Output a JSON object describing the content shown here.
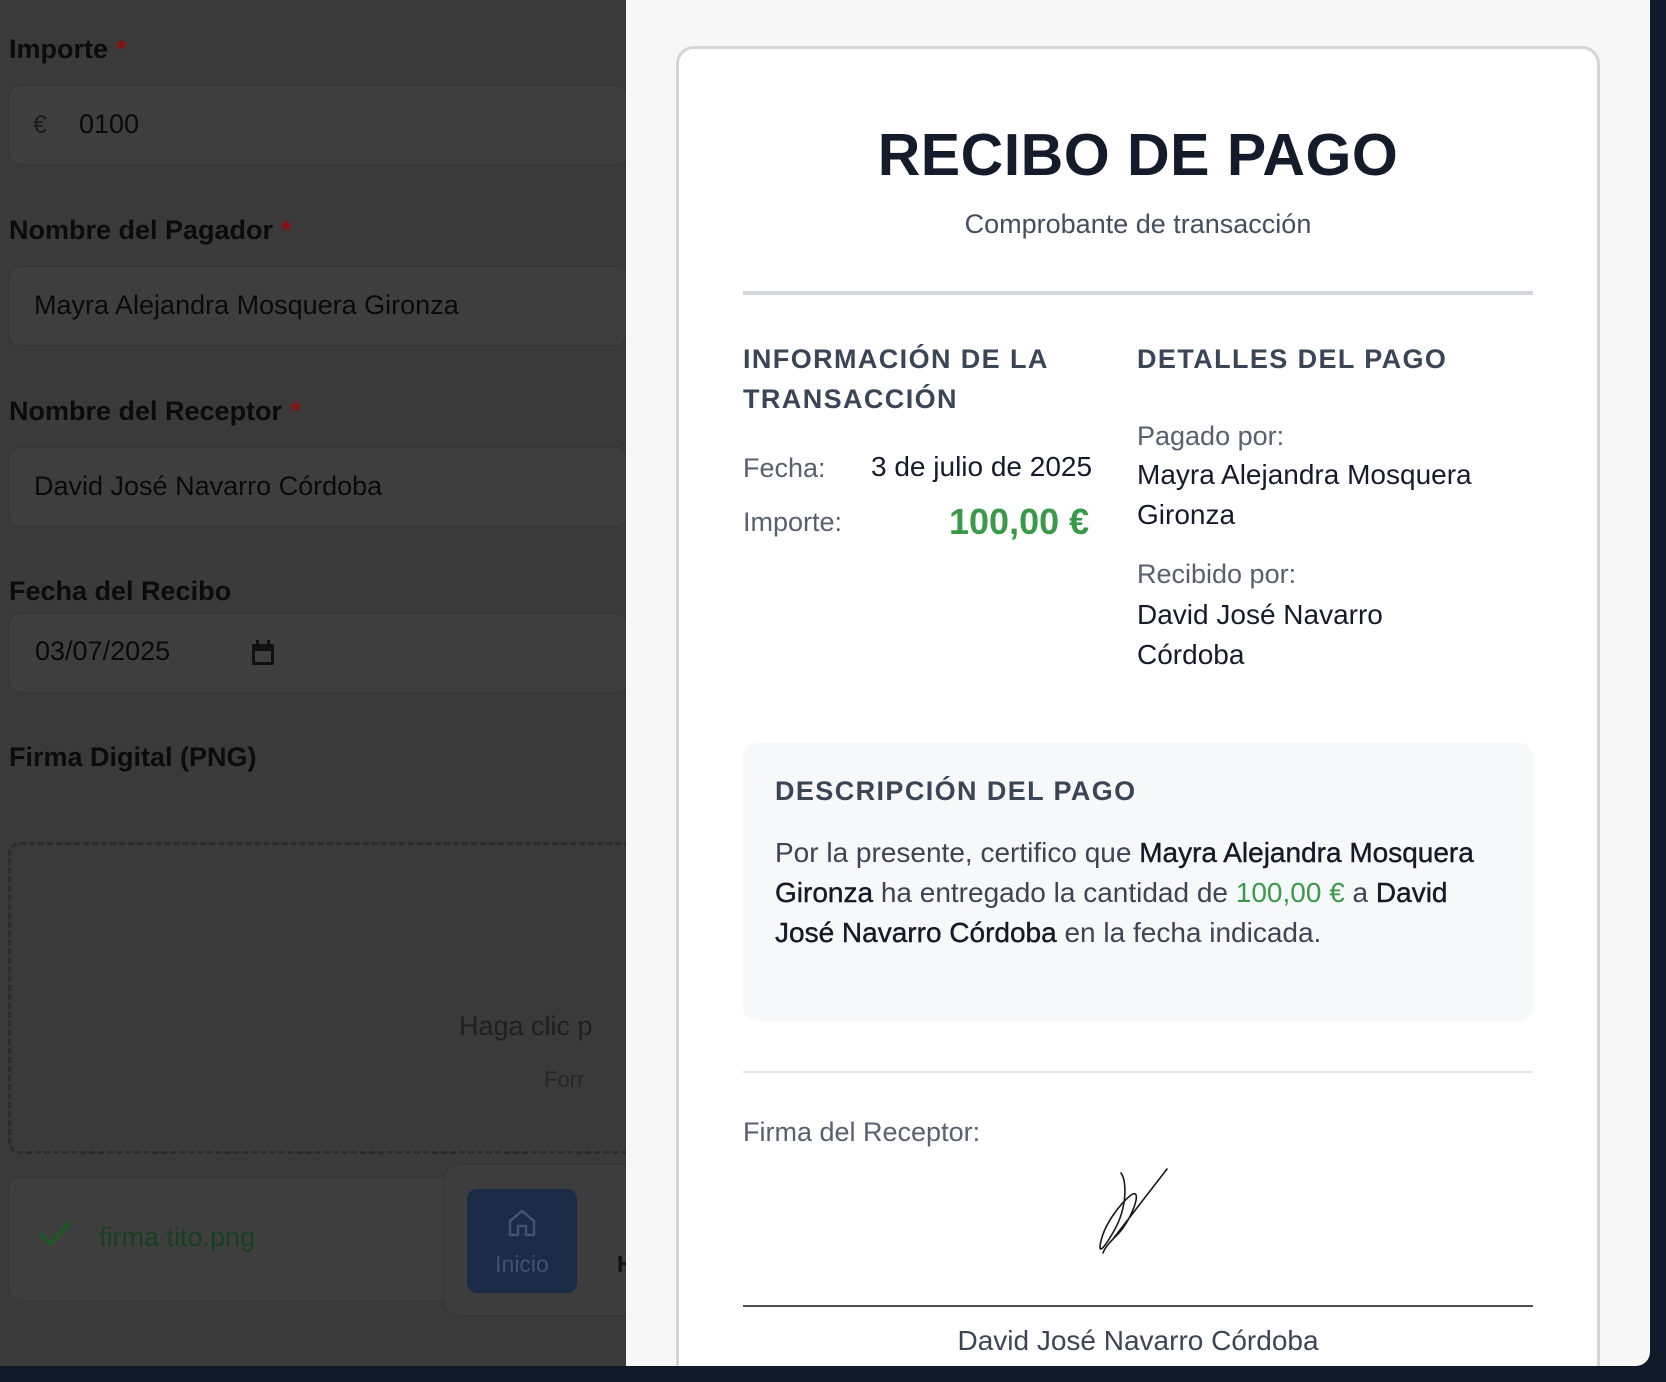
{
  "form": {
    "amount": {
      "label": "Importe",
      "required": "*",
      "currency": "€",
      "value": "0100"
    },
    "payer": {
      "label": "Nombre del Pagador",
      "required": "*",
      "value": "Mayra Alejandra Mosquera Gironza"
    },
    "receiver": {
      "label": "Nombre del Receptor",
      "required": "*",
      "value": "David José Navarro Córdoba"
    },
    "date": {
      "label": "Fecha del Recibo",
      "value": "03/07/2025"
    },
    "signature": {
      "label": "Firma Digital (PNG)",
      "dropzone_text": "Haga clic p",
      "dropzone_hint": "Forr",
      "file_name": "firma tito.png"
    },
    "nav": {
      "home_label": "Inicio",
      "next_label": "H"
    }
  },
  "receipt": {
    "title": "RECIBO DE PAGO",
    "subtitle": "Comprobante de transacción",
    "transaction": {
      "heading_line1": "INFORMACIÓN DE LA",
      "heading_line2": "TRANSACCIÓN",
      "date_label": "Fecha:",
      "date_value": "3 de julio de 2025",
      "amount_label": "Importe:",
      "amount_value": "100,00 €"
    },
    "details": {
      "heading": "DETALLES DEL PAGO",
      "paid_by_label": "Pagado por:",
      "paid_by_line1": "Mayra Alejandra Mosquera",
      "paid_by_line2": "Gironza",
      "received_by_label": "Recibido por:",
      "received_by_line1": "David José Navarro",
      "received_by_line2": "Córdoba"
    },
    "description": {
      "heading": "DESCRIPCIÓN DEL PAGO",
      "t1": "Por la presente, certifico que ",
      "payer": "Mayra Alejandra Mosquera Gironza",
      "t2": " ha entregado la cantidad de ",
      "amount": "100,00 €",
      "t3": " a ",
      "receiver": "David José Navarro Córdoba",
      "t4": " en la fecha indicada."
    },
    "signature": {
      "label": "Firma del Receptor:",
      "name": "David José Navarro Córdoba"
    }
  },
  "colors": {
    "accent_green": "#3a9a4a",
    "title_dark": "#141b2b",
    "overlay": "#3a3a3a"
  }
}
